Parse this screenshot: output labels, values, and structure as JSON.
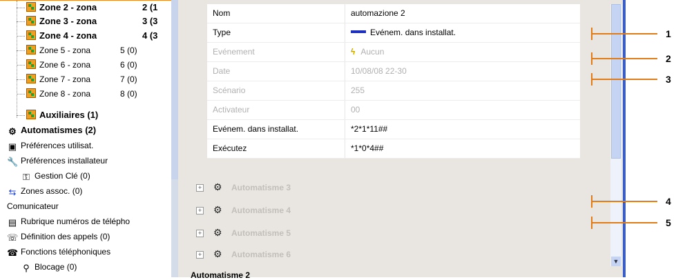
{
  "tree": {
    "zones": [
      {
        "label": "Zone 2 - zona",
        "count": "2 (1",
        "bold": true
      },
      {
        "label": "Zone 3 - zona",
        "count": "3 (3",
        "bold": true
      },
      {
        "label": "Zone 4 - zona",
        "count": "4 (3",
        "bold": true
      },
      {
        "label": "Zone 5 - zona",
        "count": "5 (0)",
        "bold": false
      },
      {
        "label": "Zone 6 - zona",
        "count": "6 (0)",
        "bold": false
      },
      {
        "label": "Zone 7 - zona",
        "count": "7 (0)",
        "bold": false
      },
      {
        "label": "Zone 8 - zona",
        "count": "8 (0)",
        "bold": false
      }
    ],
    "auxiliaires": "Auxiliaires (1)",
    "automatismes": "Automatismes (2)",
    "pref_utilisat": "Préférences utilisat.",
    "pref_installateur": "Préférences installateur",
    "gestion_cle": "Gestion Clé (0)",
    "zones_assoc": "Zones assoc. (0)",
    "comunicateur": "Comunicateur",
    "rubrique": "Rubrique numéros de télépho",
    "definition": "Définition des appels (0)",
    "fonctions": "Fonctions téléphoniques",
    "blocage": "Blocage (0)"
  },
  "props": {
    "rows": [
      {
        "key": "Nom",
        "value": "automazione 2",
        "dim": false
      },
      {
        "key": "Type",
        "value": "Evénem. dans installat.",
        "dim": false
      },
      {
        "key": "Evénement",
        "value": "Aucun",
        "dim": true
      },
      {
        "key": "Date",
        "value": "10/08/08 22-30",
        "dim": true
      },
      {
        "key": "Scénario",
        "value": "255",
        "dim": true
      },
      {
        "key": "Activateur",
        "value": "00",
        "dim": true
      },
      {
        "key": "Evénem. dans installat.",
        "value": "*2*1*11##",
        "dim": false
      },
      {
        "key": "Exécutez",
        "value": "*1*0*4##",
        "dim": false
      }
    ],
    "collapsed": [
      "Automatisme 3",
      "Automatisme 4",
      "Automatisme 5",
      "Automatisme 6"
    ],
    "bottom_title": "Automatisme 2"
  },
  "callouts": [
    "1",
    "2",
    "3",
    "4",
    "5"
  ],
  "colors": {
    "accent": "#e07b16",
    "type_bar": "#1c2fbf",
    "scroll": "#c6d4f4"
  }
}
